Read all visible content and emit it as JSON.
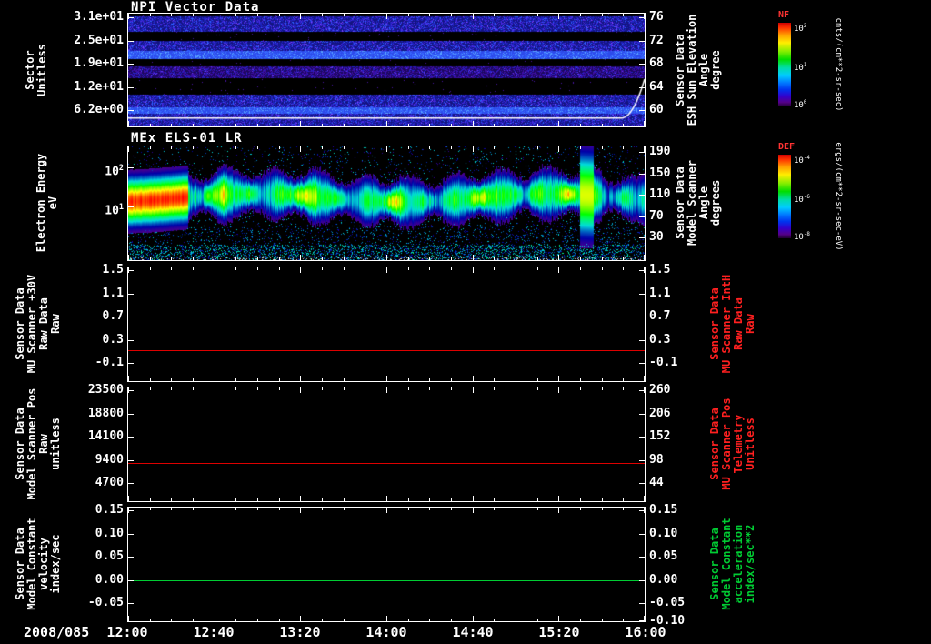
{
  "chart_data": {
    "type": "multi-panel-time-series",
    "date_label": "2008/085",
    "x_axis": {
      "start": "12:00",
      "end": "16:00",
      "ticks": [
        {
          "label": "12:00",
          "frac": 0
        },
        {
          "label": "12:40",
          "frac": 0.1667
        },
        {
          "label": "13:20",
          "frac": 0.3333
        },
        {
          "label": "14:00",
          "frac": 0.5
        },
        {
          "label": "14:40",
          "frac": 0.6667
        },
        {
          "label": "15:20",
          "frac": 0.8333
        },
        {
          "label": "16:00",
          "frac": 1
        }
      ]
    },
    "panels": [
      {
        "id": "npi",
        "title": "NPI Vector Data",
        "type": "spectrogram",
        "left_axis": {
          "title": "Sector\nUnitless",
          "color": "#ffffff",
          "ticks": [
            {
              "label": "3.1e+01",
              "frac": 0.032
            },
            {
              "label": "2.5e+01",
              "frac": 0.238
            },
            {
              "label": "1.9e+01",
              "frac": 0.444
            },
            {
              "label": "1.2e+01",
              "frac": 0.65
            },
            {
              "label": "6.2e+00",
              "frac": 0.857
            }
          ]
        },
        "right_axis": {
          "title": "Sensor Data\nESH Sun Elevation\nAngle\ndegree",
          "color": "#ffffff",
          "ticks": [
            {
              "label": "76",
              "frac": 0.032
            },
            {
              "label": "72",
              "frac": 0.238
            },
            {
              "label": "68",
              "frac": 0.444
            },
            {
              "label": "64",
              "frac": 0.65
            },
            {
              "label": "60",
              "frac": 0.857
            }
          ]
        },
        "colorbar": {
          "label": "NF",
          "label_color": "#ff3333",
          "units": "cnts/(cm**2-sr-sec)",
          "ticks": [
            {
              "label": "10^2",
              "frac": 0.03
            },
            {
              "label": "10^1",
              "frac": 0.5
            },
            {
              "label": "10^0",
              "frac": 0.95
            }
          ]
        },
        "overlay_line": {
          "color": "#ffffff",
          "base_frac": 0.925,
          "rise_start_frac": 0.955,
          "rise_to_frac": 0.58,
          "meaning": "ESH sun elevation overlay: flat near 60 deg, rising sharply just before 16:00"
        },
        "bands": [
          {
            "f0": 0.0,
            "f1": 0.02,
            "style": "black"
          },
          {
            "f0": 0.02,
            "f1": 0.16,
            "style": "speckle-blue"
          },
          {
            "f0": 0.16,
            "f1": 0.24,
            "style": "black"
          },
          {
            "f0": 0.24,
            "f1": 0.33,
            "style": "speckle-blue"
          },
          {
            "f0": 0.33,
            "f1": 0.4,
            "style": "bright-blue"
          },
          {
            "f0": 0.4,
            "f1": 0.46,
            "style": "black"
          },
          {
            "f0": 0.46,
            "f1": 0.57,
            "style": "speckle-purple"
          },
          {
            "f0": 0.57,
            "f1": 0.71,
            "style": "black"
          },
          {
            "f0": 0.71,
            "f1": 0.83,
            "style": "speckle-blue"
          },
          {
            "f0": 0.83,
            "f1": 0.88,
            "style": "bright-blue"
          },
          {
            "f0": 0.88,
            "f1": 1.0,
            "style": "speckle-blue"
          }
        ]
      },
      {
        "id": "els",
        "title": "MEx ELS-01 LR",
        "type": "spectrogram",
        "left_axis": {
          "title": "Electron Energy\neV",
          "color": "#ffffff",
          "ticks": [
            {
              "label": "10^2",
              "frac": 0.18
            },
            {
              "label": "10^1",
              "frac": 0.53
            }
          ]
        },
        "right_axis": {
          "title": "Sensor Data\nModel Scanner\nAngle\ndegrees",
          "color": "#ffffff",
          "ticks": [
            {
              "label": "190",
              "frac": 0.047
            },
            {
              "label": "150",
              "frac": 0.236
            },
            {
              "label": "110",
              "frac": 0.425
            },
            {
              "label": "70",
              "frac": 0.614
            },
            {
              "label": "30",
              "frac": 0.803
            }
          ]
        },
        "colorbar": {
          "label": "DEF",
          "label_color": "#ff3333",
          "units": "ergs/(cm**2-sr-sec-eV)",
          "ticks": [
            {
              "label": "10^-4",
              "frac": 0.03
            },
            {
              "label": "10^-6",
              "frac": 0.5
            },
            {
              "label": "10^-8",
              "frac": 0.95
            }
          ]
        },
        "band": {
          "center_frac": 0.45,
          "width_frac": 0.11,
          "hot_region_end_frac": 0.115,
          "gap_frac": [
            0.115,
            0.145
          ],
          "spike_frac": [
            0.875,
            0.9
          ],
          "description": "Intense red-orange electron flux 12:00-12:30 at ~10-100 eV, brief dark gap, then variable green-cyan band with vertical striping until 16:00; bright tall column near 15:30; blue speckle background at low energies"
        }
      },
      {
        "id": "mu-scanner-30v",
        "type": "line",
        "left_axis": {
          "title": "Sensor Data\nMU Scanner +30V\nRaw Data\nRaw",
          "color": "#ffffff",
          "ticks": [
            {
              "label": "1.5",
              "frac": 0.024
            },
            {
              "label": "1.1",
              "frac": 0.228
            },
            {
              "label": "0.7",
              "frac": 0.433
            },
            {
              "label": "0.3",
              "frac": 0.638
            },
            {
              "label": "-0.1",
              "frac": 0.843
            }
          ]
        },
        "right_axis": {
          "title": "Sensor Data\nMU Scanner IntH\nRaw Data\nRaw",
          "color": "#ff2020",
          "ticks": [
            {
              "label": "1.5",
              "frac": 0.024
            },
            {
              "label": "1.1",
              "frac": 0.228
            },
            {
              "label": "0.7",
              "frac": 0.433
            },
            {
              "label": "0.3",
              "frac": 0.638
            },
            {
              "label": "-0.1",
              "frac": 0.843
            }
          ]
        },
        "line": {
          "value": 0.12,
          "frac": 0.73,
          "color": "#dd0000"
        }
      },
      {
        "id": "scanner-pos",
        "type": "line",
        "left_axis": {
          "title": "Sensor Data\nModel Scanner Pos\nRaw\nunitless",
          "color": "#ffffff",
          "ticks": [
            {
              "label": "23500",
              "frac": 0.024
            },
            {
              "label": "18800",
              "frac": 0.228
            },
            {
              "label": "14100",
              "frac": 0.433
            },
            {
              "label": "9400",
              "frac": 0.638
            },
            {
              "label": "4700",
              "frac": 0.843
            }
          ]
        },
        "right_axis": {
          "title": "Sensor Data\nMU Scanner Pos\nTelemetry\nUnitless",
          "color": "#ff2020",
          "ticks": [
            {
              "label": "260",
              "frac": 0.024
            },
            {
              "label": "206",
              "frac": 0.228
            },
            {
              "label": "152",
              "frac": 0.433
            },
            {
              "label": "98",
              "frac": 0.638
            },
            {
              "label": "44",
              "frac": 0.843
            }
          ]
        },
        "line": {
          "value": 8700,
          "frac": 0.66,
          "color": "#dd0000"
        }
      },
      {
        "id": "model-constant",
        "type": "line",
        "left_axis": {
          "title": "Sensor Data\nModel Constant\nvelocity\nindex/sec",
          "color": "#ffffff",
          "ticks": [
            {
              "label": "0.15",
              "frac": 0.024
            },
            {
              "label": "0.10",
              "frac": 0.228
            },
            {
              "label": "0.05",
              "frac": 0.433
            },
            {
              "label": "0.00",
              "frac": 0.638
            },
            {
              "label": "-0.05",
              "frac": 0.843
            }
          ]
        },
        "right_axis": {
          "title": "Sensor Data\nModel Constant\nacceleration\nindex/sec**2",
          "color": "#00cc33",
          "ticks": [
            {
              "label": "0.15",
              "frac": 0.024
            },
            {
              "label": "0.10",
              "frac": 0.228
            },
            {
              "label": "0.05",
              "frac": 0.433
            },
            {
              "label": "0.00",
              "frac": 0.638
            },
            {
              "label": "-0.05",
              "frac": 0.843
            },
            {
              "label": "-0.10",
              "frac": 1.0
            }
          ]
        },
        "line": {
          "value": 0.0,
          "frac": 0.638,
          "color": "#00cc33"
        }
      }
    ]
  }
}
